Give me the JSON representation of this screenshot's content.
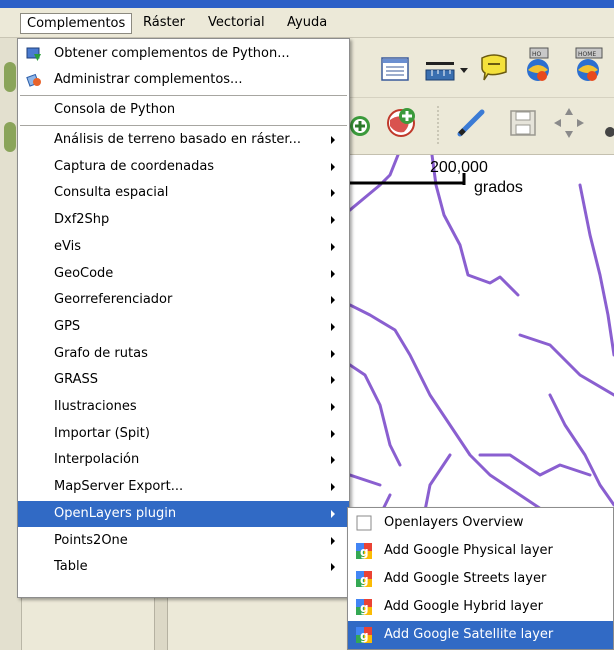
{
  "menubar": {
    "items": [
      "Complementos",
      "Ráster",
      "Vectorial",
      "Ayuda"
    ]
  },
  "menu": {
    "top_items": [
      {
        "label": "Obtener complementos de Python...",
        "icon": "python-download-icon"
      },
      {
        "label": "Administrar complementos...",
        "icon": "plugin-manager-icon"
      }
    ],
    "console_label": "Consola de Python",
    "submenus": [
      "Análisis de terreno basado en ráster...",
      "Captura de coordenadas",
      "Consulta espacial",
      "Dxf2Shp",
      "eVis",
      "GeoCode",
      "Georreferenciador",
      "GPS",
      "Grafo de rutas",
      "GRASS",
      "Ilustraciones",
      "Importar (Spit)",
      "Interpolación",
      "MapServer Export...",
      "OpenLayers plugin",
      "Points2One",
      "Table"
    ],
    "highlighted": "OpenLayers plugin"
  },
  "openlayers_submenu": {
    "items": [
      {
        "label": "Openlayers Overview",
        "icon": "checkbox-icon"
      },
      {
        "label": "Add Google Physical layer",
        "icon": "google-icon"
      },
      {
        "label": "Add Google Streets layer",
        "icon": "google-icon"
      },
      {
        "label": "Add Google Hybrid layer",
        "icon": "google-icon"
      },
      {
        "label": "Add Google Satellite layer",
        "icon": "google-icon"
      }
    ],
    "highlighted": "Add Google Satellite layer"
  },
  "map": {
    "scale_value": "200,000",
    "scale_unit": "grados",
    "line_color": "#8a5fd0"
  },
  "colors": {
    "menu_highlight": "#316ac5",
    "titlebar": "#2b5fc7"
  }
}
